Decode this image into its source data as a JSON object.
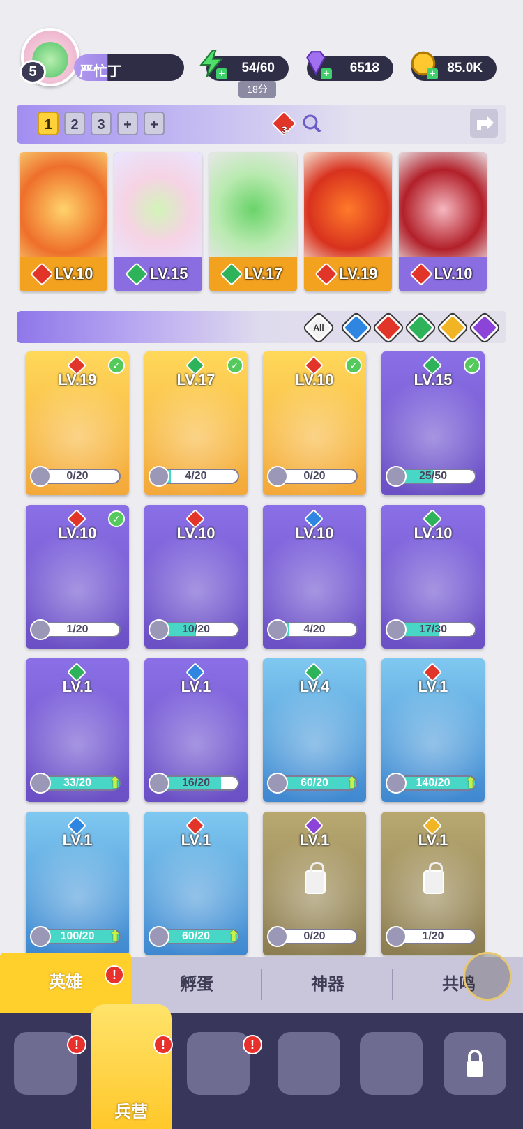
{
  "player": {
    "level": "5",
    "name": "严忙丁"
  },
  "resources": {
    "energy": {
      "value": "54/60",
      "timer": "18分"
    },
    "gems": {
      "value": "6518"
    },
    "gold": {
      "value": "85.0K"
    }
  },
  "team_bar": {
    "slots": [
      "1",
      "2",
      "3",
      "+",
      "+"
    ],
    "active_slot": "1",
    "fire_count": "3"
  },
  "team": [
    {
      "element": "fire",
      "level": "LV.10"
    },
    {
      "element": "earth",
      "level": "LV.15"
    },
    {
      "element": "earth",
      "level": "LV.17"
    },
    {
      "element": "fire",
      "level": "LV.19"
    },
    {
      "element": "fire",
      "level": "LV.10"
    }
  ],
  "filters": {
    "all_label": "All",
    "elements": [
      "water",
      "fire",
      "earth",
      "light",
      "dark"
    ]
  },
  "heroes": [
    {
      "bg": "gold",
      "element": "fire",
      "level": "LV.19",
      "progress": "0/20",
      "fill": 0,
      "checked": true
    },
    {
      "bg": "gold",
      "element": "earth",
      "level": "LV.17",
      "progress": "4/20",
      "fill": 0.2,
      "checked": true
    },
    {
      "bg": "gold",
      "element": "fire",
      "level": "LV.10",
      "progress": "0/20",
      "fill": 0,
      "checked": true
    },
    {
      "bg": "purple",
      "element": "earth",
      "level": "LV.15",
      "progress": "25/50",
      "fill": 0.5,
      "checked": true
    },
    {
      "bg": "purple",
      "element": "fire",
      "level": "LV.10",
      "progress": "1/20",
      "fill": 0.05,
      "checked": true
    },
    {
      "bg": "purple",
      "element": "fire",
      "level": "LV.10",
      "progress": "10/20",
      "fill": 0.5,
      "checked": false
    },
    {
      "bg": "purple",
      "element": "water",
      "level": "LV.10",
      "progress": "4/20",
      "fill": 0.2,
      "checked": false
    },
    {
      "bg": "purple",
      "element": "earth",
      "level": "LV.10",
      "progress": "17/30",
      "fill": 0.57,
      "checked": false
    },
    {
      "bg": "purple",
      "element": "earth",
      "level": "LV.1",
      "progress": "33/20",
      "fill": 1,
      "upgrade": true
    },
    {
      "bg": "purple",
      "element": "water",
      "level": "LV.1",
      "progress": "16/20",
      "fill": 0.8
    },
    {
      "bg": "blue",
      "element": "earth",
      "level": "LV.4",
      "progress": "60/20",
      "fill": 1,
      "upgrade": true
    },
    {
      "bg": "blue",
      "element": "fire",
      "level": "LV.1",
      "progress": "140/20",
      "fill": 1,
      "upgrade": true
    },
    {
      "bg": "blue",
      "element": "water",
      "level": "LV.1",
      "progress": "100/20",
      "fill": 1,
      "upgrade": true
    },
    {
      "bg": "blue",
      "element": "fire",
      "level": "LV.1",
      "progress": "60/20",
      "fill": 1,
      "upgrade": true
    },
    {
      "bg": "locked",
      "element": "dark",
      "level": "LV.1",
      "progress": "0/20",
      "fill": 0,
      "locked": true
    },
    {
      "bg": "locked",
      "element": "light",
      "level": "LV.1",
      "progress": "1/20",
      "fill": 0.05,
      "locked": true
    }
  ],
  "sub_tabs": [
    "英雄",
    "孵蛋",
    "神器",
    "共鸣"
  ],
  "nav": {
    "active_label": "兵营"
  },
  "colors": {
    "fire": "#e2352a",
    "earth": "#2fb35a",
    "water": "#2e86e0",
    "light": "#f1b424",
    "dark": "#8c44d8",
    "accent": "#ffcf2c"
  }
}
